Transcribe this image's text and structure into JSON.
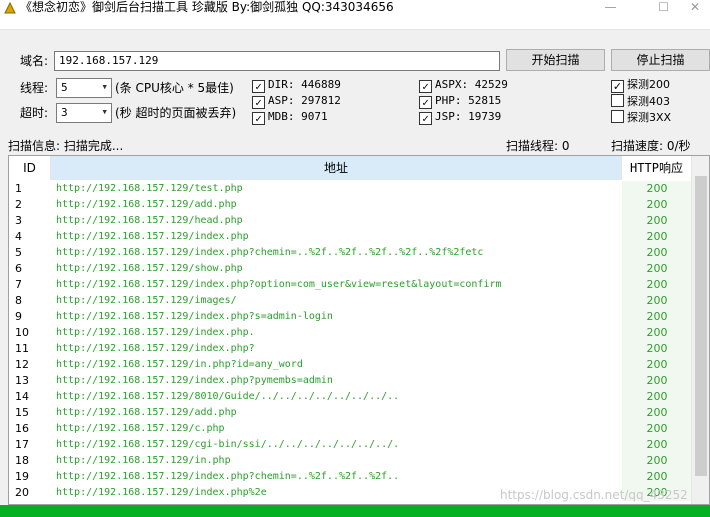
{
  "window": {
    "title": "《想念初恋》御剑后台扫描工具 珍藏版 By:御剑孤独 QQ:343034656",
    "minimize": "—",
    "maximize": "☐",
    "close": "✕"
  },
  "form": {
    "domain_label": "域名:",
    "domain_value": "192.168.157.129",
    "threads_label": "线程:",
    "threads_value": "5",
    "threads_hint": "(条 CPU核心 * 5最佳)",
    "timeout_label": "超时:",
    "timeout_value": "3",
    "timeout_hint": "(秒 超时的页面被丢弃)",
    "start_button": "开始扫描",
    "stop_button": "停止扫描"
  },
  "dicts": [
    {
      "label": "DIR: 446889",
      "checked": true
    },
    {
      "label": "ASP: 297812",
      "checked": true
    },
    {
      "label": "MDB: 9071",
      "checked": true
    },
    {
      "label": "ASPX: 42529",
      "checked": true
    },
    {
      "label": "PHP: 52815",
      "checked": true
    },
    {
      "label": "JSP: 19739",
      "checked": true
    }
  ],
  "probes": [
    {
      "label": "探测200",
      "checked": true
    },
    {
      "label": "探测403",
      "checked": false
    },
    {
      "label": "探测3XX",
      "checked": false
    }
  ],
  "status": {
    "info": "扫描信息: 扫描完成...",
    "threads": "扫描线程: 0",
    "speed": "扫描速度: 0/秒"
  },
  "table": {
    "headers": {
      "id": "ID",
      "url": "地址",
      "code": "HTTP响应"
    },
    "rows": [
      {
        "id": "1",
        "url": "http://192.168.157.129/test.php",
        "code": "200"
      },
      {
        "id": "2",
        "url": "http://192.168.157.129/add.php",
        "code": "200"
      },
      {
        "id": "3",
        "url": "http://192.168.157.129/head.php",
        "code": "200"
      },
      {
        "id": "4",
        "url": "http://192.168.157.129/index.php",
        "code": "200"
      },
      {
        "id": "5",
        "url": "http://192.168.157.129/index.php?chemin=..%2f..%2f..%2f..%2f..%2f%2fetc",
        "code": "200"
      },
      {
        "id": "6",
        "url": "http://192.168.157.129/show.php",
        "code": "200"
      },
      {
        "id": "7",
        "url": "http://192.168.157.129/index.php?option=com_user&view=reset&layout=confirm",
        "code": "200"
      },
      {
        "id": "8",
        "url": "http://192.168.157.129/images/",
        "code": "200"
      },
      {
        "id": "9",
        "url": "http://192.168.157.129/index.php?s=admin-login",
        "code": "200"
      },
      {
        "id": "10",
        "url": "http://192.168.157.129/index.php.",
        "code": "200"
      },
      {
        "id": "11",
        "url": "http://192.168.157.129/index.php?",
        "code": "200"
      },
      {
        "id": "12",
        "url": "http://192.168.157.129/in.php?id=any_word",
        "code": "200"
      },
      {
        "id": "13",
        "url": "http://192.168.157.129/index.php?pymembs=admin",
        "code": "200"
      },
      {
        "id": "14",
        "url": "http://192.168.157.129/8010/Guide/../../../../../../../..",
        "code": "200"
      },
      {
        "id": "15",
        "url": "http://192.168.157.129/add.php",
        "code": "200"
      },
      {
        "id": "16",
        "url": "http://192.168.157.129/c.php",
        "code": "200"
      },
      {
        "id": "17",
        "url": "http://192.168.157.129/cgi-bin/ssi/../../../../../../../.",
        "code": "200"
      },
      {
        "id": "18",
        "url": "http://192.168.157.129/in.php",
        "code": "200"
      },
      {
        "id": "19",
        "url": "http://192.168.157.129/index.php?chemin=..%2f..%2f..%2f..",
        "code": "200"
      },
      {
        "id": "20",
        "url": "http://192.168.157.129/index.php%2e",
        "code": "200"
      }
    ]
  },
  "watermark": "https://blog.csdn.net/qq_43252"
}
